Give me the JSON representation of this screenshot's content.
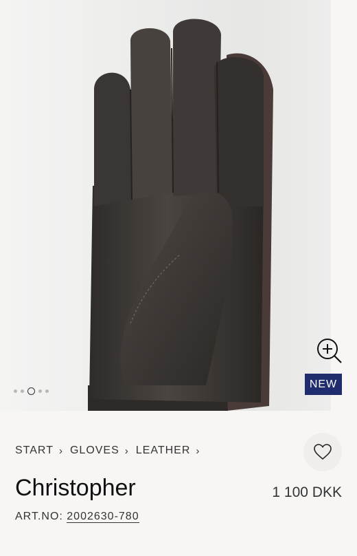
{
  "gallery": {
    "image_alt": "Christopher leather glove",
    "slide_count": 5,
    "active_slide": 3,
    "zoom_icon": "zoom-in-icon",
    "badge": "NEW",
    "badge_color": "#1f2c6e"
  },
  "breadcrumb": {
    "items": [
      "START",
      "GLOVES",
      "LEATHER"
    ]
  },
  "wishlist": {
    "icon": "heart-icon"
  },
  "product": {
    "name": "Christopher",
    "price": "1 100 DKK",
    "art_label": "ART.NO:",
    "art_number": "2002630-780"
  }
}
